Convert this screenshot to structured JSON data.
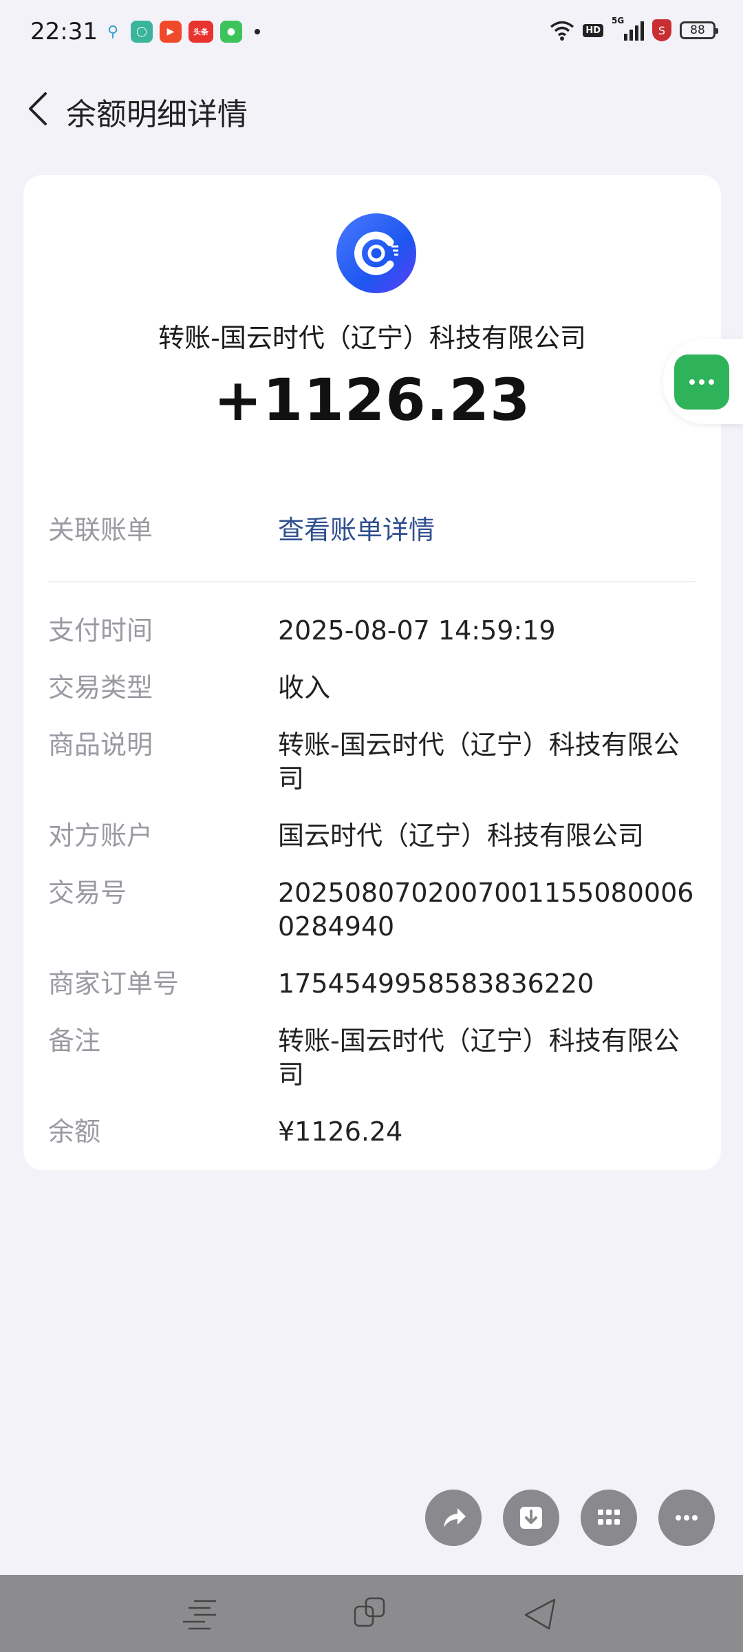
{
  "status_bar": {
    "time": "22:31",
    "battery": "88",
    "left_icons": [
      "search-icon",
      "shield-app-icon",
      "video-app-icon",
      "toutiao-app-icon",
      "green-app-icon",
      "notification-dot-icon"
    ],
    "right_icons": [
      "wifi-icon",
      "hd-icon",
      "signal-5g-icon",
      "security-icon",
      "battery-icon"
    ],
    "hd_label": "HD",
    "net_label": "5G",
    "toutiao_label": "头条"
  },
  "header": {
    "title": "余额明细详情"
  },
  "summary": {
    "merchant": "转账-国云时代（辽宁）科技有限公司",
    "amount": "+1126.23"
  },
  "linked_bill": {
    "label": "关联账单",
    "value": "查看账单详情"
  },
  "details": [
    {
      "label": "支付时间",
      "value": "2025-08-07 14:59:19"
    },
    {
      "label": "交易类型",
      "value": "收入"
    },
    {
      "label": "商品说明",
      "value": "转账-国云时代（辽宁）科技有限公司"
    },
    {
      "label": "对方账户",
      "value": "国云时代（辽宁）科技有限公司"
    },
    {
      "label": "交易号",
      "value": "2025080702007001155080006028494​0"
    },
    {
      "label": "商家订单号",
      "value": "1754549958583836220"
    },
    {
      "label": "备注",
      "value": "转账-国云时代（辽宁）科技有限公司"
    },
    {
      "label": "余额",
      "value": "¥1126.24"
    }
  ],
  "actions": [
    "share-icon",
    "download-icon",
    "grid-icon",
    "more-icon"
  ],
  "nav": [
    "menu-icon",
    "recents-icon",
    "back-icon"
  ]
}
